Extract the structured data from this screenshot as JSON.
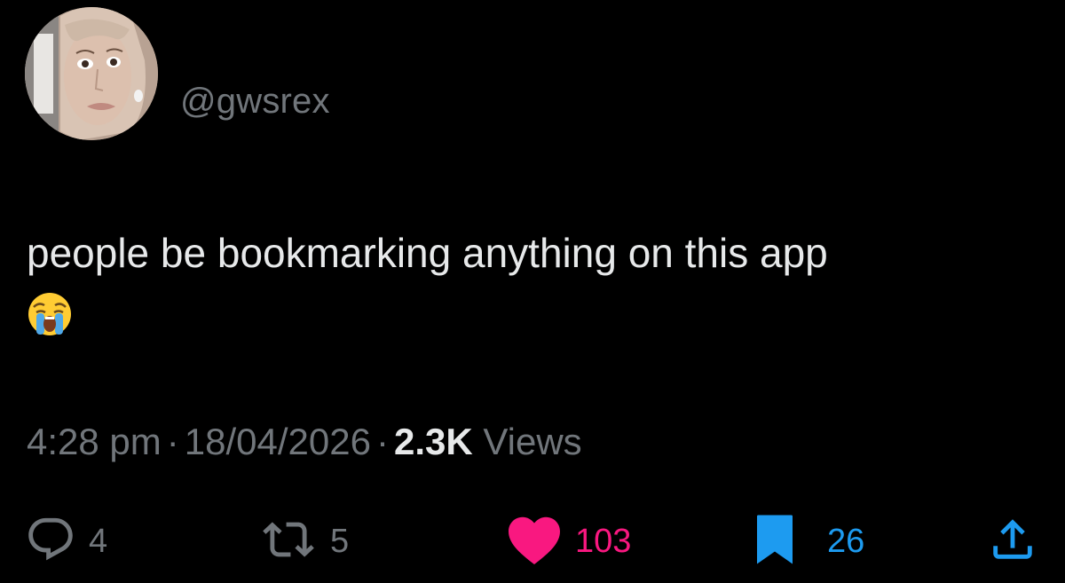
{
  "tweet": {
    "handle": "@gwsrex",
    "text": "people be bookmarking anything on this app",
    "emoji_icon": "loudly-crying-face-emoji",
    "time": "4:28 pm",
    "date": "18/04/2026",
    "separator": "·",
    "views_count": "2.3K",
    "views_label": "Views"
  },
  "actions": {
    "reply": {
      "icon": "reply-icon",
      "count": "4",
      "color": "#71767b"
    },
    "retweet": {
      "icon": "retweet-icon",
      "count": "5",
      "color": "#71767b"
    },
    "like": {
      "icon": "heart-icon",
      "count": "103",
      "color": "#f91880",
      "active": true
    },
    "bookmark": {
      "icon": "bookmark-icon",
      "count": "26",
      "color": "#1d9bf0",
      "active": true
    },
    "share": {
      "icon": "share-icon",
      "color": "#1d9bf0"
    }
  },
  "colors": {
    "background": "#000000",
    "text": "#e7e9ea",
    "secondary": "#71767b",
    "like": "#f91880",
    "bookmark": "#1d9bf0"
  }
}
